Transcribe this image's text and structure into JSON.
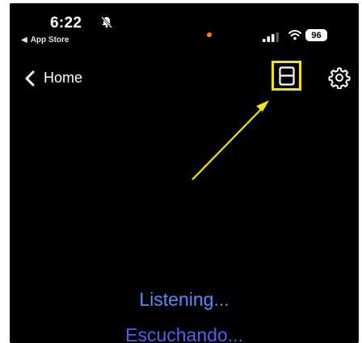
{
  "status_bar": {
    "time": "6:22",
    "back_app_label": "App Store",
    "battery_level": "96",
    "icons": [
      "bell-slash-icon",
      "signal-icon",
      "wifi-icon",
      "battery-icon"
    ],
    "dot_color": "#ff7a1a"
  },
  "nav": {
    "back_label": "Home",
    "transcript_icon": "transcript-layout-icon",
    "settings_icon": "gear-icon",
    "highlight_color": "#f2e600"
  },
  "main": {
    "status_text_en": "Listening...",
    "status_text_es": "Escuchando...",
    "status_color_en": "#5b8cff",
    "status_color_es": "#5b5cf2"
  },
  "annotation": {
    "arrow_color": "#f2e600"
  }
}
